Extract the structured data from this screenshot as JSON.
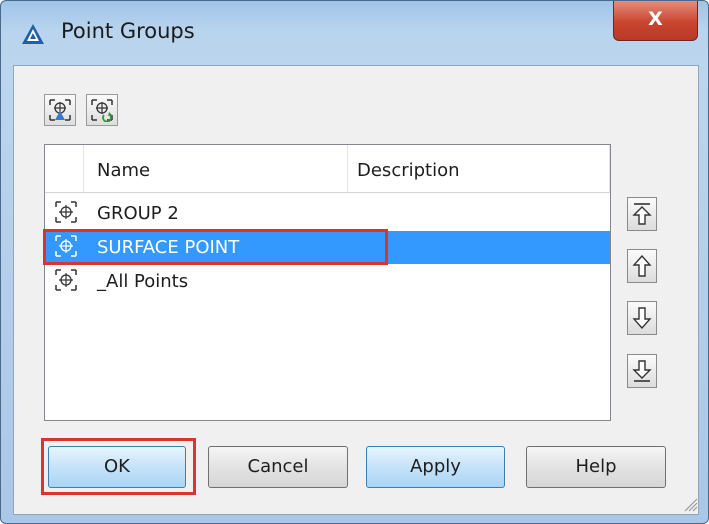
{
  "window": {
    "title": "Point Groups",
    "close_label": "X"
  },
  "list": {
    "columns": [
      {
        "label": "Name"
      },
      {
        "label": "Description"
      }
    ],
    "rows": [
      {
        "name": "GROUP 2",
        "description": "",
        "selected": false
      },
      {
        "name": "SURFACE POINT",
        "description": "",
        "selected": true
      },
      {
        "name": "_All Points",
        "description": "",
        "selected": false
      }
    ]
  },
  "buttons": {
    "ok": "OK",
    "cancel": "Cancel",
    "apply": "Apply",
    "help": "Help"
  },
  "icons": {
    "app": "autocad-civil3d-icon",
    "toolbar": [
      "point-group-properties-icon",
      "update-point-groups-icon"
    ],
    "move": [
      "move-to-top-icon",
      "move-up-icon",
      "move-down-icon",
      "move-to-bottom-icon"
    ]
  },
  "colors": {
    "selection": "#3399ff",
    "annotation": "#d9352e",
    "close_button": "#c9452f"
  }
}
